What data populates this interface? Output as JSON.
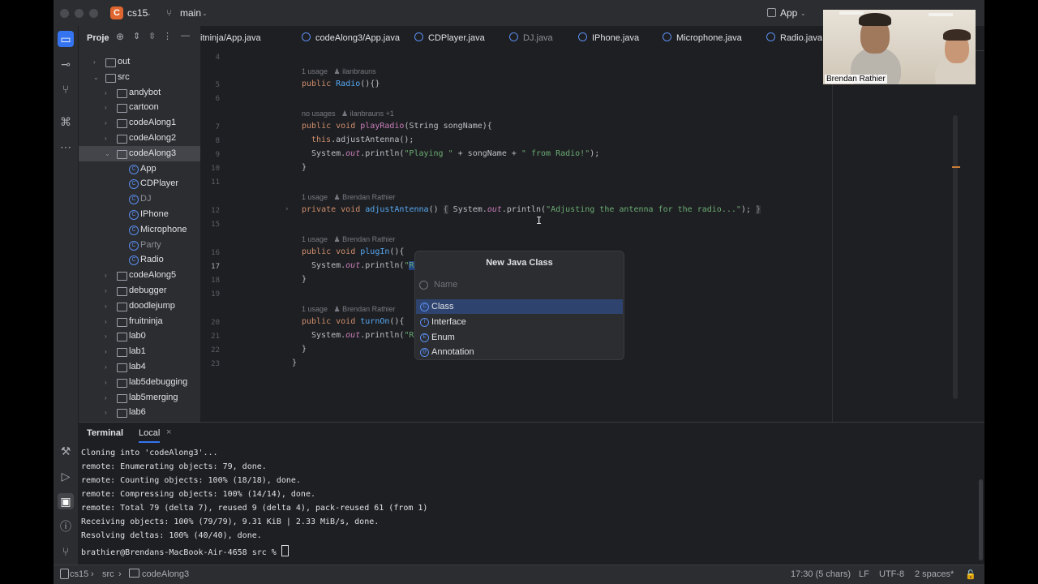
{
  "titlebar": {
    "project_badge": "C",
    "project_name": "cs15",
    "branch": "main",
    "run_config": "App"
  },
  "project_panel": {
    "title": "Proje",
    "tree": [
      {
        "label": "out",
        "kind": "folder",
        "indent": 1,
        "chev": "›"
      },
      {
        "label": "src",
        "kind": "folder",
        "indent": 1,
        "chev": "⌄"
      },
      {
        "label": "andybot",
        "kind": "folder",
        "indent": 2,
        "chev": "›"
      },
      {
        "label": "cartoon",
        "kind": "folder",
        "indent": 2,
        "chev": "›"
      },
      {
        "label": "codeAlong1",
        "kind": "folder",
        "indent": 2,
        "chev": "›"
      },
      {
        "label": "codeAlong2",
        "kind": "folder",
        "indent": 2,
        "chev": "›"
      },
      {
        "label": "codeAlong3",
        "kind": "folder",
        "indent": 2,
        "chev": "⌄",
        "selected": true
      },
      {
        "label": "App",
        "kind": "class",
        "indent": 3
      },
      {
        "label": "CDPlayer",
        "kind": "class",
        "indent": 3
      },
      {
        "label": "DJ",
        "kind": "class",
        "indent": 3,
        "dim": true
      },
      {
        "label": "IPhone",
        "kind": "class",
        "indent": 3
      },
      {
        "label": "Microphone",
        "kind": "class",
        "indent": 3
      },
      {
        "label": "Party",
        "kind": "class",
        "indent": 3,
        "dim": true
      },
      {
        "label": "Radio",
        "kind": "class",
        "indent": 3
      },
      {
        "label": "codeAlong5",
        "kind": "folder",
        "indent": 2,
        "chev": "›"
      },
      {
        "label": "debugger",
        "kind": "folder",
        "indent": 2,
        "chev": "›"
      },
      {
        "label": "doodlejump",
        "kind": "folder",
        "indent": 2,
        "chev": "›"
      },
      {
        "label": "fruitninja",
        "kind": "folder",
        "indent": 2,
        "chev": "›"
      },
      {
        "label": "lab0",
        "kind": "folder",
        "indent": 2,
        "chev": "›"
      },
      {
        "label": "lab1",
        "kind": "folder",
        "indent": 2,
        "chev": "›"
      },
      {
        "label": "lab4",
        "kind": "folder",
        "indent": 2,
        "chev": "›"
      },
      {
        "label": "lab5debugging",
        "kind": "folder",
        "indent": 2,
        "chev": "›"
      },
      {
        "label": "lab5merging",
        "kind": "folder",
        "indent": 2,
        "chev": "›"
      },
      {
        "label": "lab6",
        "kind": "folder",
        "indent": 2,
        "chev": "›"
      }
    ]
  },
  "tabs": [
    {
      "label": "itninja/App.java",
      "icon": false
    },
    {
      "label": "codeAlong3/App.java",
      "icon": true
    },
    {
      "label": "CDPlayer.java",
      "icon": true
    },
    {
      "label": "DJ.java",
      "icon": true,
      "dim": true
    },
    {
      "label": "IPhone.java",
      "icon": true
    },
    {
      "label": "Microphone.java",
      "icon": true
    },
    {
      "label": "Radio.java",
      "icon": true,
      "active": true
    }
  ],
  "editor": {
    "line_numbers": [
      "4",
      "5",
      "6",
      "7",
      "8",
      "9",
      "10",
      "11",
      "12",
      "15",
      "16",
      "17",
      "18",
      "19",
      "20",
      "21",
      "22",
      "23"
    ],
    "hint_1_usage": "1 usage",
    "hint_1_author": "ilanbrauns",
    "hint_2_usage": "no usages",
    "hint_2_author": "ilanbrauns +1",
    "hint_3_usage": "1 usage",
    "hint_3_author": "Brendan Rathier",
    "hint_4_usage": "1 usage",
    "hint_4_author": "Brendan Rathier",
    "hint_5_usage": "1 usage",
    "hint_5_author": "Brendan Rathier"
  },
  "popup": {
    "title": "New Java Class",
    "placeholder": "Name",
    "items": [
      {
        "label": "Class",
        "icon": "C",
        "selected": true
      },
      {
        "label": "Interface",
        "icon": "I"
      },
      {
        "label": "Enum",
        "icon": "E"
      },
      {
        "label": "Annotation",
        "icon": "@"
      }
    ]
  },
  "terminal": {
    "title": "Terminal",
    "tab": "Local",
    "lines": [
      "Cloning into 'codeAlong3'...",
      "remote: Enumerating objects: 79, done.",
      "remote: Counting objects: 100% (18/18), done.",
      "remote: Compressing objects: 100% (14/14), done.",
      "remote: Total 79 (delta 7), reused 9 (delta 4), pack-reused 61 (from 1)",
      "Receiving objects: 100% (79/79), 9.31 KiB | 2.33 MiB/s, done.",
      "Resolving deltas: 100% (40/40), done."
    ],
    "prompt": "brathier@Brendans-MacBook-Air-4658 src % "
  },
  "statusbar": {
    "crumbs": [
      "cs15",
      "src",
      "codeAlong3"
    ],
    "position": "17:30 (5 chars)",
    "line_sep": "LF",
    "encoding": "UTF-8",
    "indent": "2 spaces*"
  },
  "video": {
    "name": "Brendan Rathier"
  }
}
